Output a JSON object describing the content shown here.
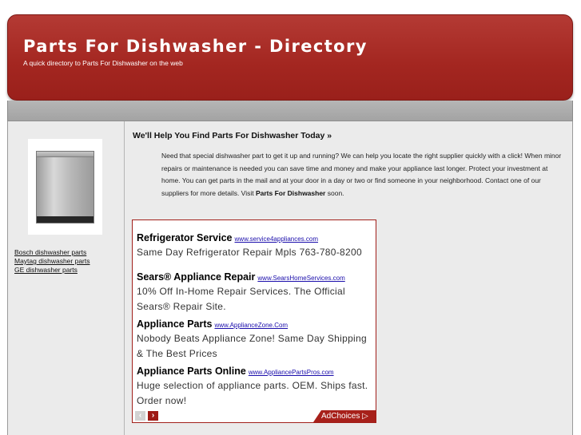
{
  "header": {
    "title": "Parts For Dishwasher - Directory",
    "subtitle": "A quick directory to Parts For Dishwasher on the web"
  },
  "sidebar": {
    "links": [
      "Bosch dishwasher parts",
      "Maytag dishwasher parts",
      "GE dishwasher parts"
    ]
  },
  "content": {
    "heading": "We'll Help You Find Parts For Dishwasher Today »",
    "paragraph": "Need that special dishwasher part to get it up and running? We can help you locate the right supplier quickly with a click! When minor repairs or maintenance is needed you can save time and money and make your appliance last longer. Protect your investment at home. You can get parts in the mail and at your door in a day or two or find someone in your neighborhood. Contact one of our suppliers for more details. Visit",
    "paragraph_bold": "Parts For Dishwasher",
    "paragraph_end": "soon."
  },
  "ads": {
    "items": [
      {
        "title": "Refrigerator Service",
        "url": "www.service4appliances.com",
        "desc": "Same Day Refrigerator Repair Mpls 763-780-8200"
      },
      {
        "title": "Sears® Appliance Repair",
        "url": "www.SearsHomeServices.com",
        "desc": "10% Off In-Home Repair Services. The Official Sears® Repair Site."
      },
      {
        "title": "Appliance Parts",
        "url": "www.ApplianceZone.Com",
        "desc": "Nobody Beats Appliance Zone! Same Day Shipping & The Best Prices"
      },
      {
        "title": "Appliance Parts Online",
        "url": "www.AppliancePartsPros.com",
        "desc": "Huge selection of appliance parts. OEM. Ships fast. Order now!"
      }
    ],
    "prev_icon": "chevron-left-icon",
    "next_icon": "chevron-right-icon",
    "adchoices_label": "AdChoices ▷"
  },
  "colors": {
    "header_red": "#a32620",
    "main_bg": "#ebebeb",
    "ad_border": "#a11f1a"
  }
}
